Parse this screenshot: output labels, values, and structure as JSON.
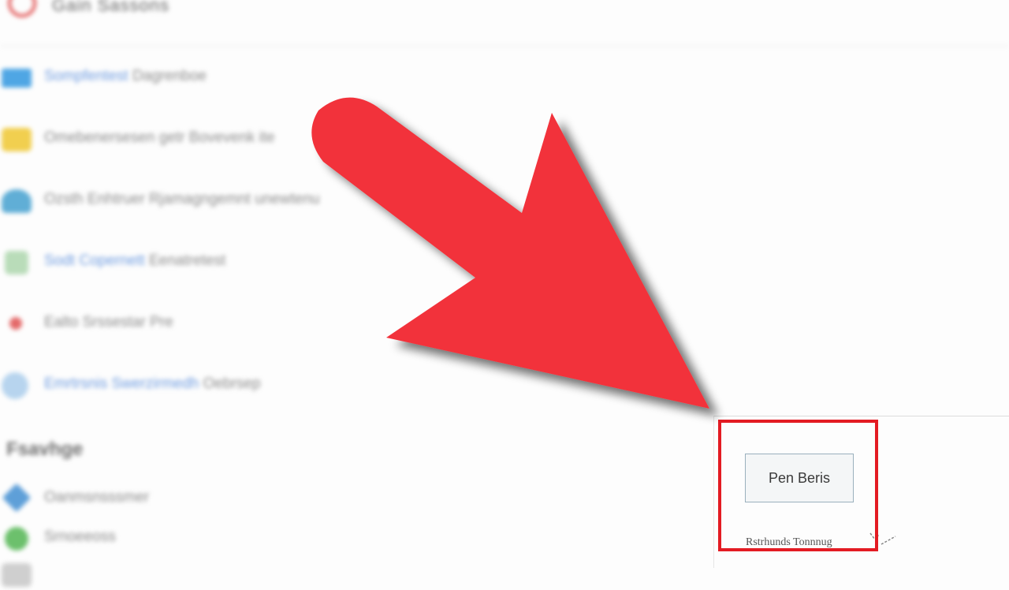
{
  "header": {
    "title": "Gain Sassons"
  },
  "list": [
    {
      "link": "Sompfentest",
      "text": "Dagrenboe",
      "icon": "monitor-icon"
    },
    {
      "link": "",
      "text": "Omebenersesen getr Bovevenk ite",
      "icon": "folder-icon"
    },
    {
      "link": "",
      "text": "Ozsth Enhtruer Rjamagngemnt unewtenu",
      "icon": "user-icon"
    },
    {
      "link": "Sodt Copernett",
      "text": "Eenatretest",
      "icon": "document-icon"
    },
    {
      "link": "",
      "text": "Ealto Srssestar Pre",
      "icon": "star-icon"
    },
    {
      "link": "Emrtrsnis Swerzirmedh",
      "text": "Oebrsep",
      "icon": "globe-icon"
    }
  ],
  "section": {
    "title": "Fsavhge",
    "items": [
      {
        "text": "Oanmsnsssmer",
        "icon": "pin-icon"
      },
      {
        "text": "Srnoeeoss",
        "icon": "chat-icon"
      },
      {
        "text": "",
        "icon": "misc-icon"
      }
    ]
  },
  "panel": {
    "button_label": "Pen Beris",
    "caption": "Rstrhunds Tonnnug"
  },
  "overlay": {
    "arrow_color": "#f2333b",
    "highlight_color": "#e31b23"
  }
}
